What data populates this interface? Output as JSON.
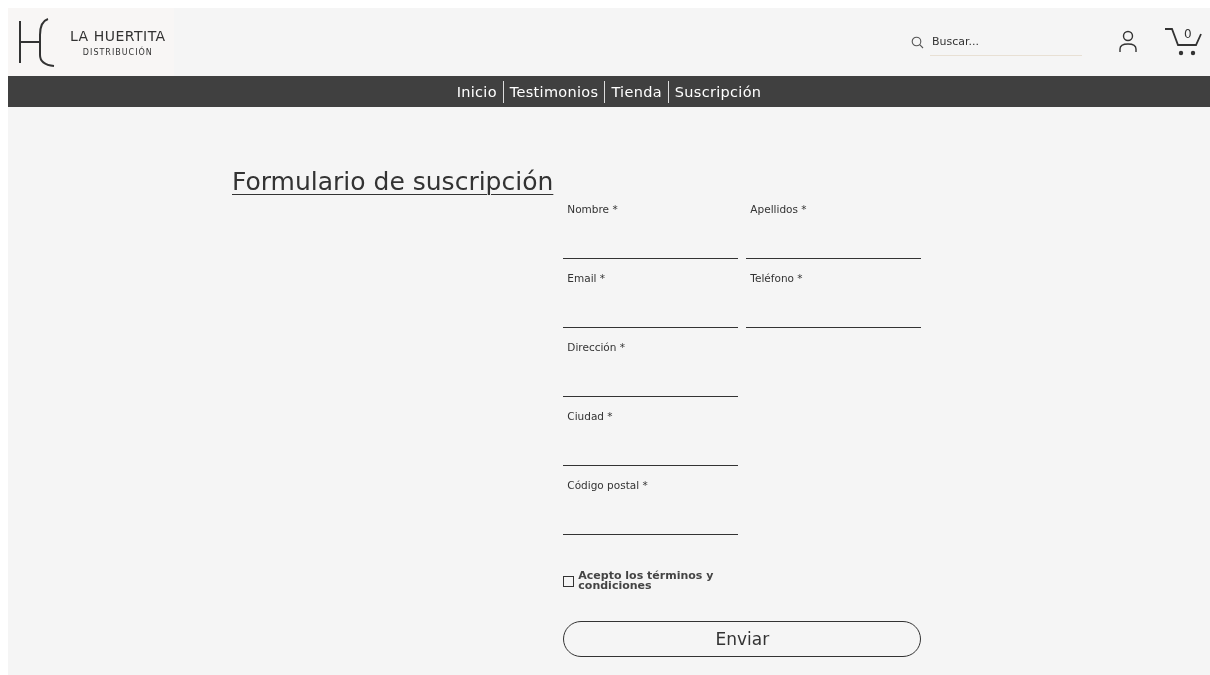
{
  "header": {
    "logo": {
      "name": "LA HUERTITA",
      "tagline": "DISTRIBUCIÓN"
    },
    "search": {
      "placeholder": "Buscar..."
    },
    "cart_count": "0"
  },
  "nav": [
    "Inicio",
    "Testimonios",
    "Tienda",
    "Suscripción"
  ],
  "form": {
    "title": "Formulario de suscripción",
    "rows": [
      [
        {
          "label": "Nombre *"
        },
        {
          "label": "Apellidos *"
        }
      ],
      [
        {
          "label": "Email *"
        },
        {
          "label": "Teléfono *"
        }
      ],
      [
        {
          "label": "Dirección *"
        }
      ],
      [
        {
          "label": "Ciudad *"
        }
      ],
      [
        {
          "label": "Código postal *"
        }
      ]
    ],
    "terms": {
      "label": "Acepto los términos y condiciones",
      "checked": false
    },
    "submit": "Enviar"
  }
}
